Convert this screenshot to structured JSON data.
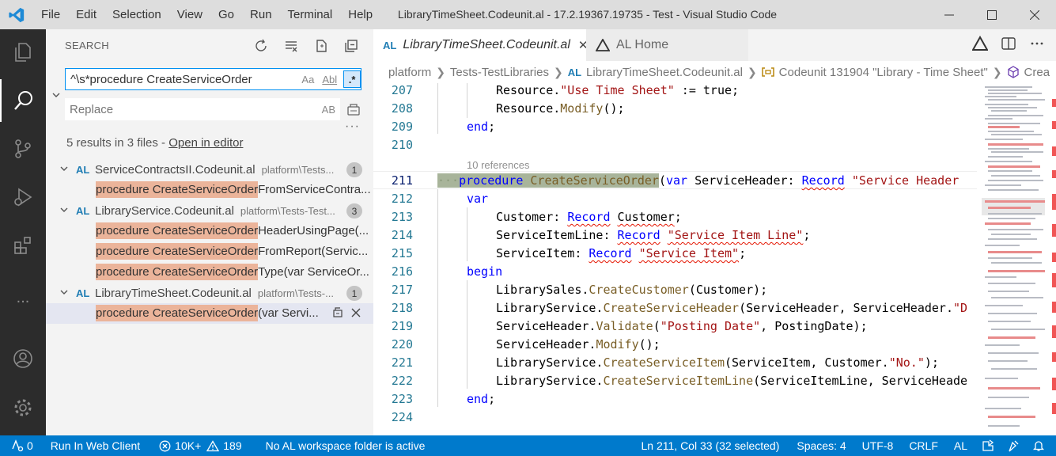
{
  "titlebar": {
    "menu": [
      "File",
      "Edit",
      "Selection",
      "View",
      "Go",
      "Run",
      "Terminal",
      "Help"
    ],
    "title": "LibraryTimeSheet.Codeunit.al - 17.2.19367.19735 - Test - Visual Studio Code"
  },
  "activitybar": {
    "items": [
      "explorer-icon",
      "search-icon",
      "source-control-icon",
      "run-debug-icon",
      "extensions-icon",
      "more-icon",
      "accounts-icon",
      "manage-gear-icon"
    ],
    "more_label": "..."
  },
  "search": {
    "title": "SEARCH",
    "query": "^\\s*procedure CreateServiceOrder",
    "match_case": "Aa",
    "whole_word": "Abl",
    "regex": ".*",
    "replace_placeholder": "Replace",
    "preserve_case": "AB",
    "more": "···",
    "summary_prefix": "5 results in 3 files - ",
    "open_in_editor": "Open in editor"
  },
  "results": [
    {
      "al": "AL",
      "file": "ServiceContractsII.Codeunit.al",
      "path": "platform\\Tests...",
      "count": "1",
      "matches": [
        {
          "hl": "procedure CreateServiceOrder",
          "rest": "FromServiceContra..."
        }
      ]
    },
    {
      "al": "AL",
      "file": "LibraryService.Codeunit.al",
      "path": "platform\\Tests-Test...",
      "count": "3",
      "matches": [
        {
          "hl": "procedure CreateServiceOrder",
          "rest": "HeaderUsingPage(..."
        },
        {
          "hl": "procedure CreateServiceOrder",
          "rest": "FromReport(Servic..."
        },
        {
          "hl": "procedure CreateServiceOrder",
          "rest": "Type(var ServiceOr..."
        }
      ]
    },
    {
      "al": "AL",
      "file": "LibraryTimeSheet.Codeunit.al",
      "path": "platform\\Tests-...",
      "count": "1",
      "matches": [
        {
          "hl": "procedure CreateServiceOrder",
          "rest": "(var Servi..."
        }
      ]
    }
  ],
  "tabs": [
    {
      "al": "AL",
      "label": "LibraryTimeSheet.Codeunit.al",
      "close": "✕"
    },
    {
      "label": "AL Home"
    }
  ],
  "breadcrumb": {
    "items": [
      "platform",
      "Tests-TestLibraries",
      "LibraryTimeSheet.Codeunit.al",
      "Codeunit 131904 \"Library - Time Sheet\"",
      "Crea"
    ],
    "al": "AL"
  },
  "editor": {
    "codelens": "10 references",
    "line_numbers": [
      "207",
      "208",
      "209",
      "210",
      "211",
      "212",
      "213",
      "214",
      "215",
      "216",
      "217",
      "218",
      "219",
      "220",
      "221",
      "222",
      "223",
      "224"
    ]
  },
  "statusbar": {
    "ports": "0",
    "run": "Run In Web Client",
    "errors": "10K+",
    "warnings": "189",
    "workspace": "No AL workspace folder is active",
    "position": "Ln 211, Col 33 (32 selected)",
    "spaces": "Spaces: 4",
    "encoding": "UTF-8",
    "eol": "CRLF",
    "language": "AL"
  },
  "colors": {
    "accent": "#007acc",
    "activitybar": "#2c2c2c",
    "search_highlight": "#ebb49a",
    "selection": "#a8b49a"
  }
}
